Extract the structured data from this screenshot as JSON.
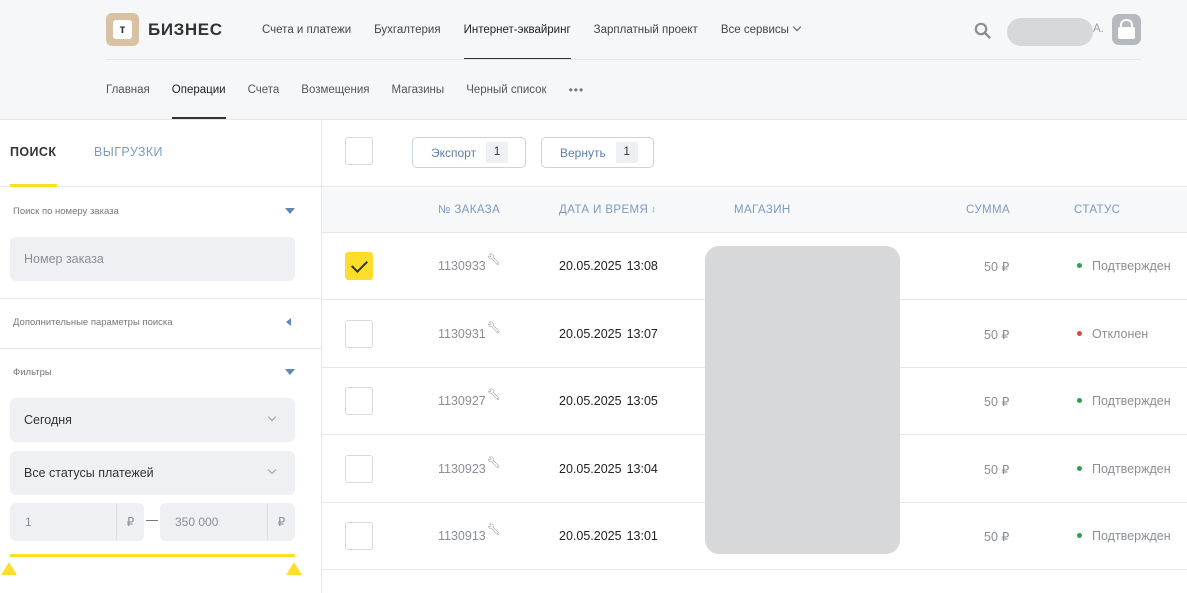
{
  "brand": {
    "logo_letter": "т",
    "name": "БИЗНЕС"
  },
  "top_nav": {
    "items": [
      "Счета и платежи",
      "Бухгалтерия",
      "Интернет-эквайринг",
      "Зарплатный проект",
      "Все сервисы"
    ],
    "active_index": 2
  },
  "user": {
    "initial": "А."
  },
  "sub_nav": {
    "items": [
      "Главная",
      "Операции",
      "Счета",
      "Возмещения",
      "Магазины",
      "Черный список"
    ],
    "more": "•••",
    "active_index": 1
  },
  "left_panel": {
    "tabs": [
      "ПОИСК",
      "ВЫГРУЗКИ"
    ],
    "order_search": {
      "label": "Поиск по номеру заказа",
      "placeholder": "Номер заказа",
      "value": ""
    },
    "extra_params_label": "Дополнительные параметры поиска",
    "filters": {
      "label": "Фильтры",
      "period": "Сегодня",
      "payment_status": "Все статусы платежей",
      "amount_from": "1",
      "amount_to": "350 000",
      "currency": "₽"
    }
  },
  "toolbar": {
    "export": {
      "label": "Экспорт",
      "count": "1"
    },
    "refund": {
      "label": "Вернуть",
      "count": "1"
    }
  },
  "table": {
    "columns": [
      "№ ЗАКАЗА",
      "ДАТА И ВРЕМЯ",
      "МАГАЗИН",
      "СУММА",
      "СТАТУС"
    ],
    "sort_icon": "↕",
    "rows": [
      {
        "checked": true,
        "order": "1130933",
        "date": "20.05.2025",
        "time": "13:08",
        "sum": "50 ₽",
        "status": "Подтвержден",
        "status_color": "#2e9e4f"
      },
      {
        "checked": false,
        "order": "1130931",
        "date": "20.05.2025",
        "time": "13:07",
        "sum": "50 ₽",
        "status": "Отклонен",
        "status_color": "#e0443e"
      },
      {
        "checked": false,
        "order": "1130927",
        "date": "20.05.2025",
        "time": "13:05",
        "sum": "50 ₽",
        "status": "Подтвержден",
        "status_color": "#2e9e4f"
      },
      {
        "checked": false,
        "order": "1130923",
        "date": "20.05.2025",
        "time": "13:04",
        "sum": "50 ₽",
        "status": "Подтвержден",
        "status_color": "#2e9e4f"
      },
      {
        "checked": false,
        "order": "1130913",
        "date": "20.05.2025",
        "time": "13:01",
        "sum": "50 ₽",
        "status": "Подтвержден",
        "status_color": "#2e9e4f"
      }
    ]
  },
  "colors": {
    "accent": "#ffdd2d",
    "link": "#5f87b8",
    "confirmed": "#2e9e4f",
    "rejected": "#e0443e"
  }
}
